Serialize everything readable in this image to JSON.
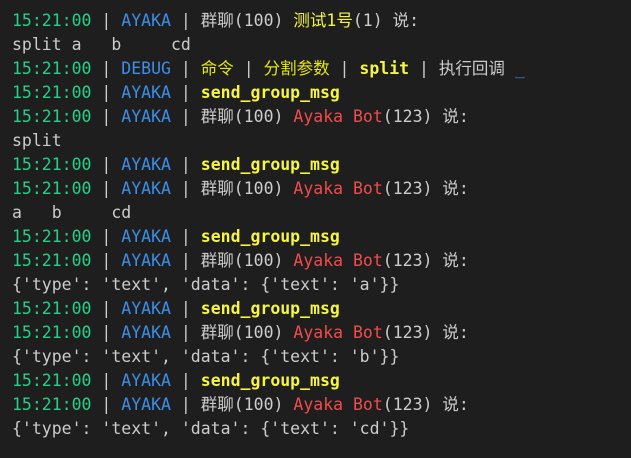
{
  "terminal": {
    "lines": [
      {
        "kind": "chat",
        "time": "15:21:00",
        "level": "AYAKA",
        "group": "群聊(100)",
        "name": "测试1号",
        "uid": "(1)",
        "says": "说:",
        "bot": false
      },
      {
        "kind": "text",
        "text": "split a   b     cd"
      },
      {
        "kind": "debug",
        "time": "15:21:00",
        "level": "DEBUG",
        "p1": "命令",
        "p2": "分割参数",
        "p3": "split",
        "p4": "执行回调",
        "tail": "_"
      },
      {
        "kind": "cmd",
        "time": "15:21:00",
        "level": "AYAKA",
        "cmd": "send_group_msg"
      },
      {
        "kind": "chat",
        "time": "15:21:00",
        "level": "AYAKA",
        "group": "群聊(100)",
        "name": "Ayaka Bot",
        "uid": "(123)",
        "says": "说:",
        "bot": true
      },
      {
        "kind": "text",
        "text": "split"
      },
      {
        "kind": "cmd",
        "time": "15:21:00",
        "level": "AYAKA",
        "cmd": "send_group_msg"
      },
      {
        "kind": "chat",
        "time": "15:21:00",
        "level": "AYAKA",
        "group": "群聊(100)",
        "name": "Ayaka Bot",
        "uid": "(123)",
        "says": "说:",
        "bot": true
      },
      {
        "kind": "text",
        "text": "a   b     cd"
      },
      {
        "kind": "cmd",
        "time": "15:21:00",
        "level": "AYAKA",
        "cmd": "send_group_msg"
      },
      {
        "kind": "chat",
        "time": "15:21:00",
        "level": "AYAKA",
        "group": "群聊(100)",
        "name": "Ayaka Bot",
        "uid": "(123)",
        "says": "说:",
        "bot": true
      },
      {
        "kind": "text",
        "text": "{'type': 'text', 'data': {'text': 'a'}}"
      },
      {
        "kind": "cmd",
        "time": "15:21:00",
        "level": "AYAKA",
        "cmd": "send_group_msg"
      },
      {
        "kind": "chat",
        "time": "15:21:00",
        "level": "AYAKA",
        "group": "群聊(100)",
        "name": "Ayaka Bot",
        "uid": "(123)",
        "says": "说:",
        "bot": true
      },
      {
        "kind": "text",
        "text": "{'type': 'text', 'data': {'text': 'b'}}"
      },
      {
        "kind": "cmd",
        "time": "15:21:00",
        "level": "AYAKA",
        "cmd": "send_group_msg"
      },
      {
        "kind": "chat",
        "time": "15:21:00",
        "level": "AYAKA",
        "group": "群聊(100)",
        "name": "Ayaka Bot",
        "uid": "(123)",
        "says": "说:",
        "bot": true
      },
      {
        "kind": "text",
        "text": "{'type': 'text', 'data': {'text': 'cd'}}"
      }
    ],
    "colors": {
      "background": "#1e1e1e",
      "timestamp": "#23d18b",
      "level": "#3b8eea",
      "default_text": "#cccccc",
      "command": "#f5f543",
      "user_name": "#f5f543",
      "bot_name": "#f14c4c"
    }
  }
}
